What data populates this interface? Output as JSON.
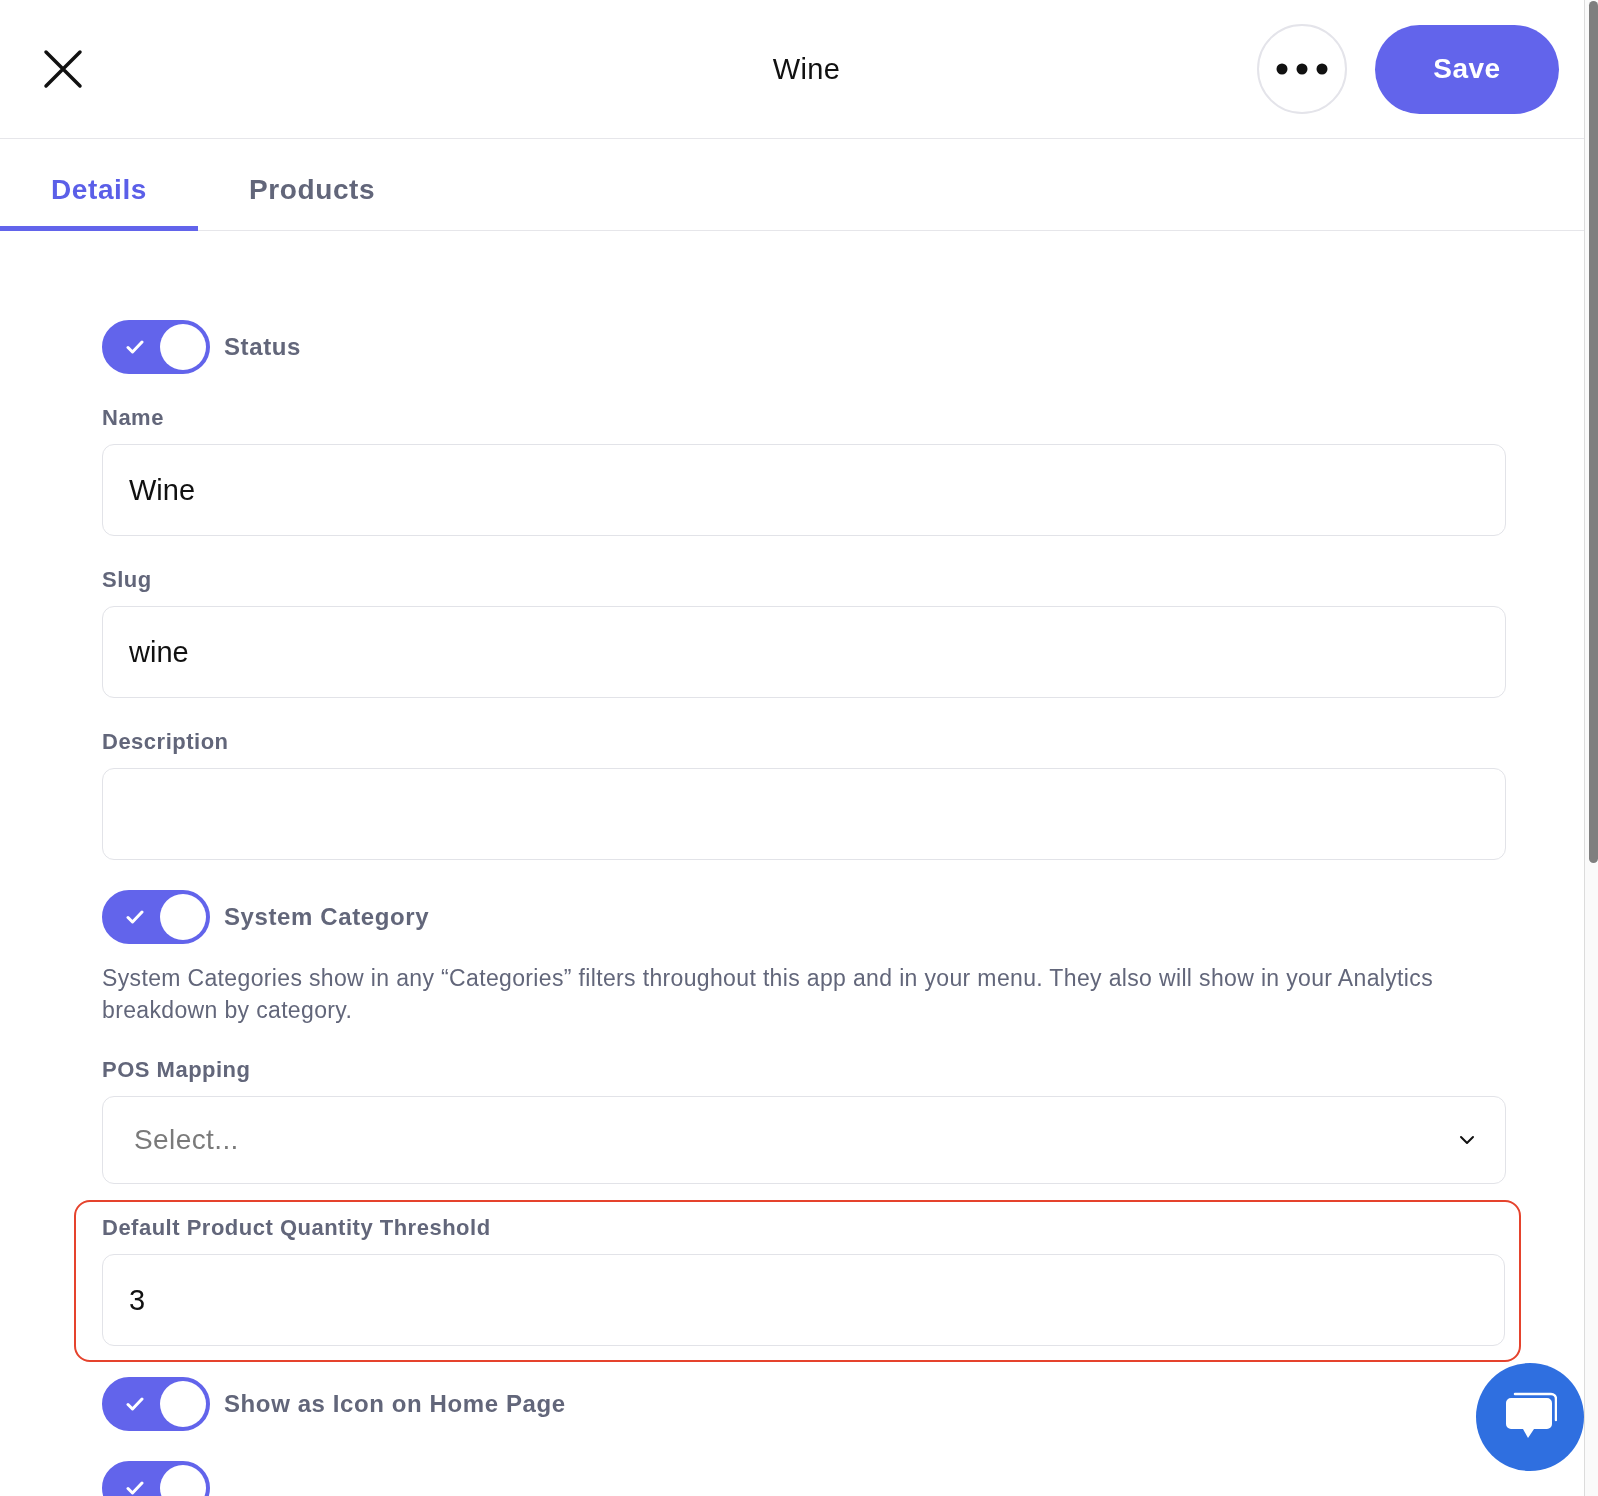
{
  "header": {
    "title": "Wine",
    "save_label": "Save"
  },
  "tabs": [
    {
      "label": "Details",
      "selected": true
    },
    {
      "label": "Products",
      "selected": false
    }
  ],
  "form": [
    {
      "kind": "toggle",
      "label": "Status",
      "on": true
    },
    {
      "kind": "text",
      "label": "Name",
      "value": "Wine"
    },
    {
      "kind": "text",
      "label": "Slug",
      "value": "wine"
    },
    {
      "kind": "text",
      "label": "Description"
    },
    {
      "kind": "toggle",
      "label": "System Category",
      "on": true,
      "note": "System Categories show in any “Categories” filters throughout this app and in your menu. They also will show in your Analytics breakdown by category."
    },
    {
      "kind": "select",
      "label": "POS Mapping",
      "placeholder": "Select..."
    },
    {
      "kind": "text",
      "label": "Default Product Quantity Threshold",
      "value": "3",
      "highlighted": true
    },
    {
      "kind": "toggle",
      "label": "Show as Icon on Home Page",
      "on": true
    },
    {
      "kind": "toggle",
      "on": true
    }
  ]
}
